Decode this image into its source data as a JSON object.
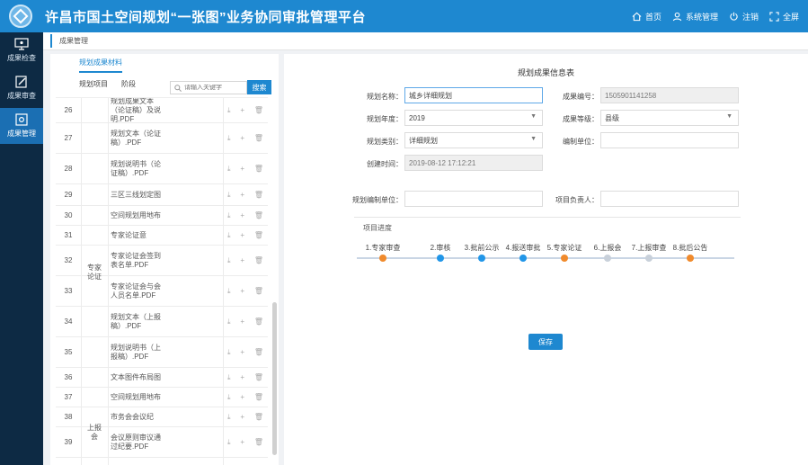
{
  "header": {
    "title": "许昌市国土空间规划“一张图”业务协同审批管理平台",
    "nav": [
      {
        "label": "首页",
        "icon": "home-icon"
      },
      {
        "label": "系统管理",
        "icon": "user-icon"
      },
      {
        "label": "注销",
        "icon": "power-icon"
      },
      {
        "label": "全屏",
        "icon": "fullscreen-icon"
      }
    ]
  },
  "leftnav": [
    {
      "label": "成果检查",
      "icon": "monitor-icon",
      "active": false
    },
    {
      "label": "成果审查",
      "icon": "edit-icon",
      "active": false
    },
    {
      "label": "成果管理",
      "icon": "settings-icon",
      "active": true
    }
  ],
  "breadcrumb": {
    "tab": "成果管理"
  },
  "lpanel": {
    "tab": "规划成果材料",
    "tree_label_1": "规划项目",
    "tree_label_2": "阶段",
    "search_placeholder": "请输入关键字",
    "search_button": "搜索",
    "actions": [
      "⤓",
      "+",
      "🗑"
    ],
    "groups": [
      {
        "label": "专家论证"
      },
      {
        "label": "上报会"
      }
    ],
    "rows": [
      {
        "num": "26",
        "file": "规划成果文本（论证稿）及说明.PDF"
      },
      {
        "num": "27",
        "file": "规划文本（论证稿）.PDF"
      },
      {
        "num": "28",
        "file": "规划说明书（论证稿）.PDF"
      },
      {
        "num": "29",
        "file": "三区三线划定图"
      },
      {
        "num": "30",
        "file": "空间规划用地布局图"
      },
      {
        "num": "31",
        "file": "专家论证意见.PDF"
      },
      {
        "num": "32",
        "file": "专家论证会签到表名单.PDF"
      },
      {
        "num": "33",
        "file": "专家论证会与会人员名单.PDF"
      },
      {
        "num": "34",
        "file": "规划文本（上报稿）.PDF"
      },
      {
        "num": "35",
        "file": "规划说明书（上报稿）.PDF"
      },
      {
        "num": "36",
        "file": "文本图件布局图"
      },
      {
        "num": "37",
        "file": "空间规划用地布局图"
      },
      {
        "num": "38",
        "file": "市务会会议纪要.PDF"
      },
      {
        "num": "39",
        "file": "会议原则审议通过纪要.PDF"
      }
    ]
  },
  "form": {
    "title": "规划成果信息表",
    "fields": {
      "plan_name_label": "规划名称：",
      "plan_name_value": "城乡详细规划",
      "result_no_label": "成果编号：",
      "result_no_value": "1505901141258",
      "plan_year_label": "规划年度：",
      "plan_year_value": "2019",
      "result_level_label": "成果等级：",
      "result_level_value": "县级",
      "plan_type_label": "规划类别：",
      "plan_type_value": "详细规划",
      "org_label": "编制单位：",
      "org_value": "",
      "created_label": "创建时间：",
      "created_value": "2019-08-12 17:12:21",
      "maker_label": "规划编制单位：",
      "maker_value": "",
      "owner_label": "项目负责人：",
      "owner_value": ""
    },
    "progress_label": "项目进度",
    "steps": [
      {
        "label": "1.专家审查",
        "color": "#f08a2c"
      },
      {
        "label": "2.审核",
        "color": "#2196e8"
      },
      {
        "label": "3.批前公示",
        "color": "#2196e8"
      },
      {
        "label": "4.报送审批",
        "color": "#2196e8"
      },
      {
        "label": "5.专家论证",
        "color": "#f08a2c"
      },
      {
        "label": "6.上报会",
        "color": "#c8d0da"
      },
      {
        "label": "7.上报审查",
        "color": "#c8d0da"
      },
      {
        "label": "8.批后公告",
        "color": "#f08a2c"
      }
    ],
    "save_button": "保存"
  }
}
